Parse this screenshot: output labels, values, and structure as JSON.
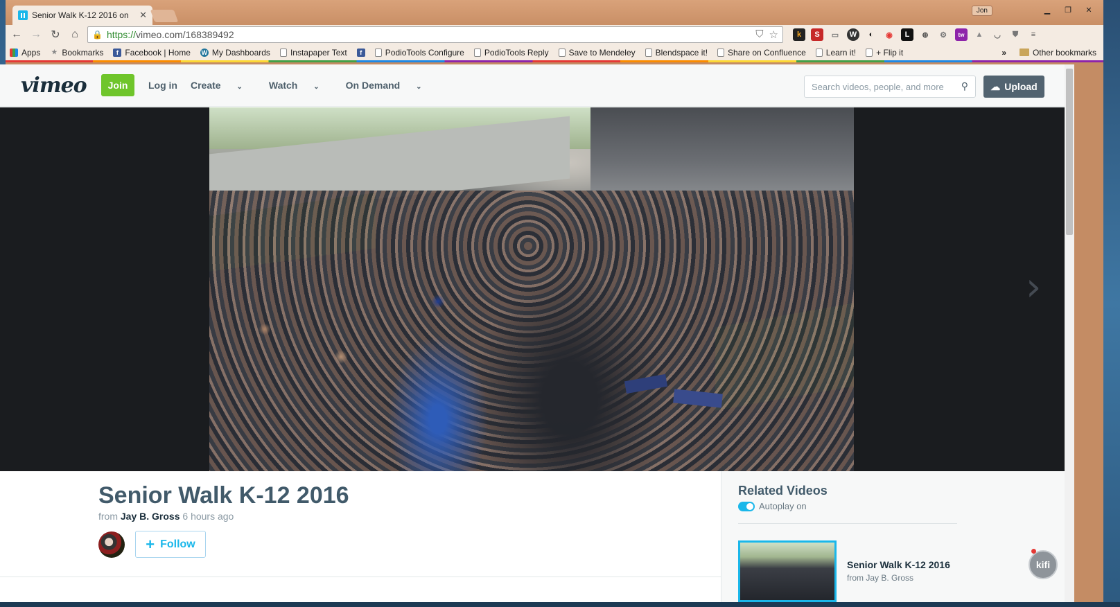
{
  "browser": {
    "tab_title": "Senior Walk K-12 2016 on",
    "profile": "Jon",
    "url_scheme": "https://",
    "url_rest": "vimeo.com/168389492"
  },
  "bookmarks": [
    {
      "label": "Apps",
      "icon": "apps-icon"
    },
    {
      "label": "Bookmarks",
      "icon": "star-icon"
    },
    {
      "label": "Facebook | Home",
      "icon": "facebook-icon"
    },
    {
      "label": "My Dashboards",
      "icon": "wordpress-icon"
    },
    {
      "label": "Instapaper Text",
      "icon": "page-icon"
    },
    {
      "label": "",
      "icon": "facebook-icon"
    },
    {
      "label": "PodioTools Configure",
      "icon": "page-icon"
    },
    {
      "label": "PodioTools Reply",
      "icon": "page-icon"
    },
    {
      "label": "Save to Mendeley",
      "icon": "page-icon"
    },
    {
      "label": "Blendspace it!",
      "icon": "page-icon"
    },
    {
      "label": "Share on Confluence",
      "icon": "page-icon"
    },
    {
      "label": "Learn it!",
      "icon": "page-icon"
    },
    {
      "label": "+ Flip it",
      "icon": "page-icon"
    }
  ],
  "bookmarks_more": "»",
  "other_bookmarks": "Other bookmarks",
  "vimeo": {
    "logo": "vimeo",
    "join": "Join",
    "nav": {
      "login": "Log in",
      "create": "Create",
      "watch": "Watch",
      "on_demand": "On Demand"
    },
    "search_placeholder": "Search videos, people, and more",
    "upload": "Upload"
  },
  "video": {
    "title": "Senior Walk K-12 2016",
    "from_prefix": "from",
    "author": "Jay B. Gross",
    "time_ago": "6 hours ago",
    "follow": "Follow"
  },
  "related": {
    "heading": "Related Videos",
    "autoplay": "Autoplay on",
    "items": [
      {
        "title": "Senior Walk K-12 2016",
        "from": "from Jay B. Gross"
      }
    ]
  },
  "kifi": "kifi"
}
